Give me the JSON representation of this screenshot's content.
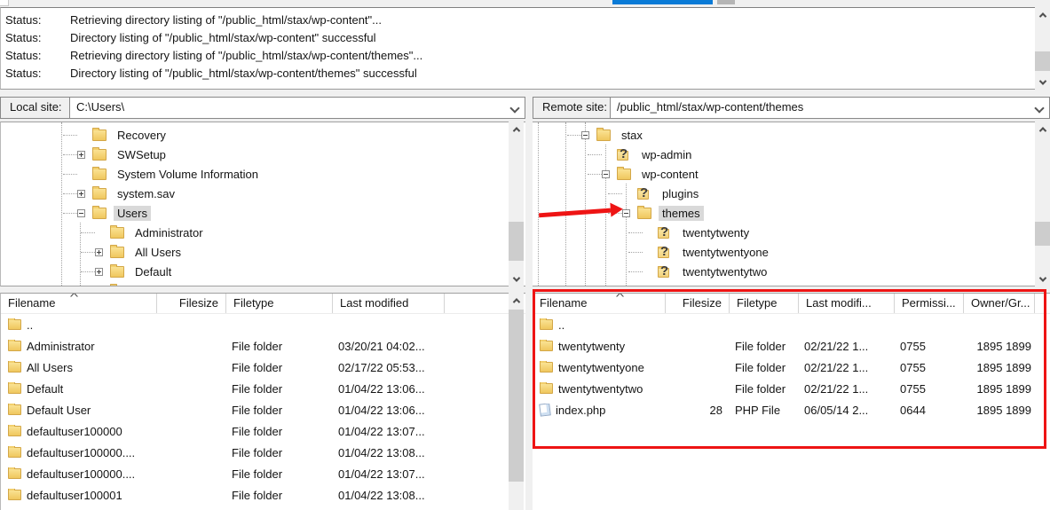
{
  "accent": {
    "progress_blue": "#0a7bd7",
    "annotation_red": "#ee1414"
  },
  "status_log": {
    "entries": [
      {
        "label": "Status:",
        "message": "Retrieving directory listing of \"/public_html/stax/wp-content\"..."
      },
      {
        "label": "Status:",
        "message": "Directory listing of \"/public_html/stax/wp-content\" successful"
      },
      {
        "label": "Status:",
        "message": "Retrieving directory listing of \"/public_html/stax/wp-content/themes\"..."
      },
      {
        "label": "Status:",
        "message": "Directory listing of \"/public_html/stax/wp-content/themes\" successful"
      }
    ]
  },
  "local": {
    "site_label": "Local site:",
    "site_path": "C:\\Users\\",
    "tree": [
      {
        "text": "Recovery",
        "level": 0,
        "expander": "none",
        "icon": "folder",
        "selected": false
      },
      {
        "text": "SWSetup",
        "level": 0,
        "expander": "plus",
        "icon": "folder",
        "selected": false
      },
      {
        "text": "System Volume Information",
        "level": 0,
        "expander": "none",
        "icon": "folder",
        "selected": false
      },
      {
        "text": "system.sav",
        "level": 0,
        "expander": "plus",
        "icon": "folder",
        "selected": false
      },
      {
        "text": "Users",
        "level": 0,
        "expander": "minus",
        "icon": "folder",
        "selected": true
      },
      {
        "text": "Administrator",
        "level": 1,
        "expander": "none",
        "icon": "folder",
        "selected": false
      },
      {
        "text": "All Users",
        "level": 1,
        "expander": "plus",
        "icon": "folder",
        "selected": false
      },
      {
        "text": "Default",
        "level": 1,
        "expander": "plus",
        "icon": "folder",
        "selected": false
      },
      {
        "text": "",
        "level": 1,
        "expander": "none",
        "icon": "folder",
        "selected": false
      }
    ],
    "list": {
      "sort_indicator": "^",
      "columns": {
        "filename": "Filename",
        "filesize": "Filesize",
        "filetype": "Filetype",
        "modified": "Last modified"
      },
      "rows": [
        {
          "text": "..",
          "icon": "folder",
          "size": "",
          "type": "",
          "modified": ""
        },
        {
          "text": "Administrator",
          "icon": "folder",
          "size": "",
          "type": "File folder",
          "modified": "03/20/21 04:02..."
        },
        {
          "text": "All Users",
          "icon": "folder",
          "size": "",
          "type": "File folder",
          "modified": "02/17/22 05:53..."
        },
        {
          "text": "Default",
          "icon": "folder",
          "size": "",
          "type": "File folder",
          "modified": "01/04/22 13:06..."
        },
        {
          "text": "Default User",
          "icon": "folder",
          "size": "",
          "type": "File folder",
          "modified": "01/04/22 13:06..."
        },
        {
          "text": "defaultuser100000",
          "icon": "folder",
          "size": "",
          "type": "File folder",
          "modified": "01/04/22 13:07..."
        },
        {
          "text": "defaultuser100000....",
          "icon": "folder",
          "size": "",
          "type": "File folder",
          "modified": "01/04/22 13:08..."
        },
        {
          "text": "defaultuser100000....",
          "icon": "folder",
          "size": "",
          "type": "File folder",
          "modified": "01/04/22 13:07..."
        },
        {
          "text": "defaultuser100001",
          "icon": "folder",
          "size": "",
          "type": "File folder",
          "modified": "01/04/22 13:08..."
        }
      ]
    }
  },
  "remote": {
    "site_label": "Remote site:",
    "site_path": "/public_html/stax/wp-content/themes",
    "tree": [
      {
        "text": "stax",
        "level": 0,
        "expander": "minus",
        "icon": "folder",
        "selected": false
      },
      {
        "text": "wp-admin",
        "level": 1,
        "expander": "none",
        "icon": "qfolder",
        "selected": false
      },
      {
        "text": "wp-content",
        "level": 1,
        "expander": "minus",
        "icon": "folder",
        "selected": false
      },
      {
        "text": "plugins",
        "level": 2,
        "expander": "none",
        "icon": "qfolder",
        "selected": false
      },
      {
        "text": "themes",
        "level": 2,
        "expander": "minus",
        "icon": "folder",
        "selected": true
      },
      {
        "text": "twentytwenty",
        "level": 3,
        "expander": "none",
        "icon": "qfolder",
        "selected": false
      },
      {
        "text": "twentytwentyone",
        "level": 3,
        "expander": "none",
        "icon": "qfolder",
        "selected": false
      },
      {
        "text": "twentytwentytwo",
        "level": 3,
        "expander": "none",
        "icon": "qfolder",
        "selected": false
      },
      {
        "text": "",
        "level": 3,
        "expander": "none",
        "icon": "qfolder",
        "selected": false
      }
    ],
    "list": {
      "sort_indicator": "^",
      "columns": {
        "filename": "Filename",
        "filesize": "Filesize",
        "filetype": "Filetype",
        "modified": "Last modifi...",
        "permissions": "Permissi...",
        "owner": "Owner/Gr..."
      },
      "rows": [
        {
          "text": "..",
          "icon": "folder",
          "size": "",
          "type": "",
          "modified": "",
          "perms": "",
          "owner": ""
        },
        {
          "text": "twentytwenty",
          "icon": "folder",
          "size": "",
          "type": "File folder",
          "modified": "02/21/22 1...",
          "perms": "0755",
          "owner": "1895 1899"
        },
        {
          "text": "twentytwentyone",
          "icon": "folder",
          "size": "",
          "type": "File folder",
          "modified": "02/21/22 1...",
          "perms": "0755",
          "owner": "1895 1899"
        },
        {
          "text": "twentytwentytwo",
          "icon": "folder",
          "size": "",
          "type": "File folder",
          "modified": "02/21/22 1...",
          "perms": "0755",
          "owner": "1895 1899"
        },
        {
          "text": "index.php",
          "icon": "php",
          "size": "28",
          "type": "PHP File",
          "modified": "06/05/14 2...",
          "perms": "0644",
          "owner": "1895 1899"
        }
      ]
    }
  }
}
